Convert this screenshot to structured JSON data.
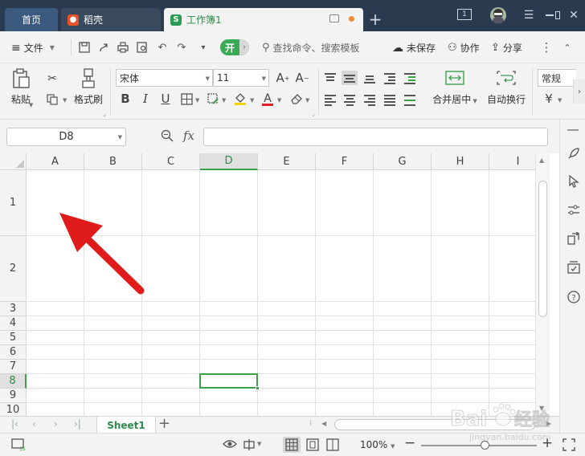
{
  "tabs": {
    "home": "首页",
    "daoke": "稻壳",
    "workbook": "工作簿1"
  },
  "window": {
    "badge": "1"
  },
  "menubar": {
    "file": "文件",
    "start": "开",
    "search_placeholder": "查找命令、搜索模板",
    "unsaved": "未保存",
    "collaborate": "协作",
    "share": "分享"
  },
  "ribbon": {
    "paste": "粘贴",
    "format_painter": "格式刷",
    "font_name": "宋体",
    "font_size": "11",
    "merge_center": "合并居中",
    "wrap_text": "自动换行",
    "number_format": "常规",
    "currency_symbol": "¥"
  },
  "formula_bar": {
    "name_box": "D8",
    "fx": "fx",
    "formula": ""
  },
  "grid": {
    "columns": [
      "A",
      "B",
      "C",
      "D",
      "E",
      "F",
      "G",
      "H",
      "I"
    ],
    "rows": [
      "1",
      "2",
      "3",
      "4",
      "5",
      "6",
      "7",
      "8",
      "9",
      "10"
    ],
    "selected_cell": "D8",
    "selected_column": "D",
    "selected_row": "8"
  },
  "sheets": {
    "active": "Sheet1"
  },
  "statusbar": {
    "zoom": "100%",
    "zoom_level": 0.55
  },
  "colors": {
    "accent_green": "#2a8c4a",
    "selection_green": "#3aa04a",
    "titlebar": "#2a3b50",
    "annotation_arrow": "#e01b1b"
  },
  "watermark": {
    "text": "Bai度经验",
    "sub": "jingyan.baidu.com"
  }
}
